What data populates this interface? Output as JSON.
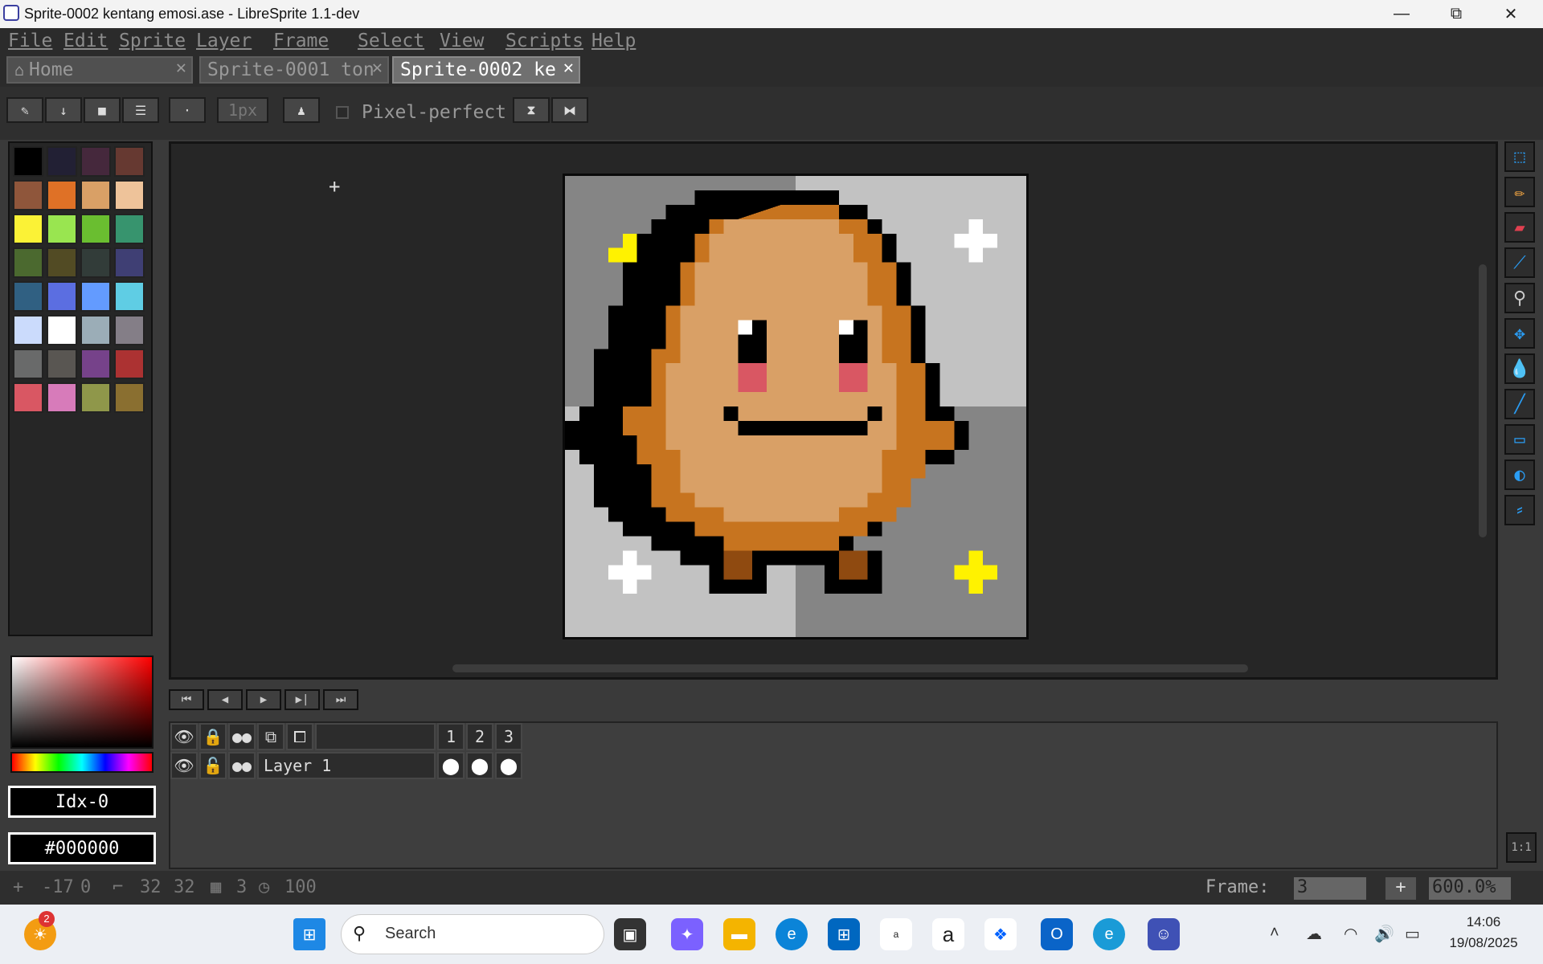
{
  "window": {
    "title": "Sprite-0002 kentang emosi.ase - LibreSprite 1.1-dev",
    "minimize": "—",
    "maximize": "⧉",
    "close": "✕"
  },
  "menu": [
    "File",
    "Edit",
    "Sprite",
    "Layer",
    "Frame",
    "Select",
    "View",
    "Scripts",
    "Help"
  ],
  "tabs": [
    {
      "label": "Home",
      "active": false
    },
    {
      "label": "Sprite-0001 ton",
      "active": false
    },
    {
      "label": "Sprite-0002 ke",
      "active": true
    }
  ],
  "context_bar": {
    "brush_size": "1px",
    "pixel_perfect_label": "Pixel-perfect",
    "pixel_perfect_checked": false
  },
  "palette": {
    "colors": [
      "#000000",
      "#222034",
      "#45283c",
      "#663931",
      "#8f563b",
      "#df7126",
      "#d9a066",
      "#eec39a",
      "#fbf236",
      "#99e550",
      "#6abe30",
      "#37946e",
      "#4b692f",
      "#524b24",
      "#323c39",
      "#3f3f74",
      "#306082",
      "#5b6ee1",
      "#639bff",
      "#5fcde4",
      "#cbdbfc",
      "#ffffff",
      "#9badb7",
      "#847e87",
      "#696a6a",
      "#595652",
      "#76428a",
      "#ac3232",
      "#d95763",
      "#d77bba",
      "#8f974a",
      "#8a6f30"
    ]
  },
  "color": {
    "index_label": "Idx-0",
    "hex_label": "#000000"
  },
  "timeline": {
    "frames": [
      "1",
      "2",
      "3"
    ],
    "layer_name": "Layer 1"
  },
  "status": {
    "cursor_x": "-17",
    "cursor_y": "0",
    "size_w": "32",
    "size_h": "32",
    "frames_count": "3",
    "duration": "100",
    "frame_label": "Frame:",
    "frame_value": "3",
    "zoom": "600.0%"
  },
  "taskbar": {
    "search_placeholder": "Search",
    "time": "14:06",
    "date": "19/08/2025",
    "weather_badge": "2"
  }
}
